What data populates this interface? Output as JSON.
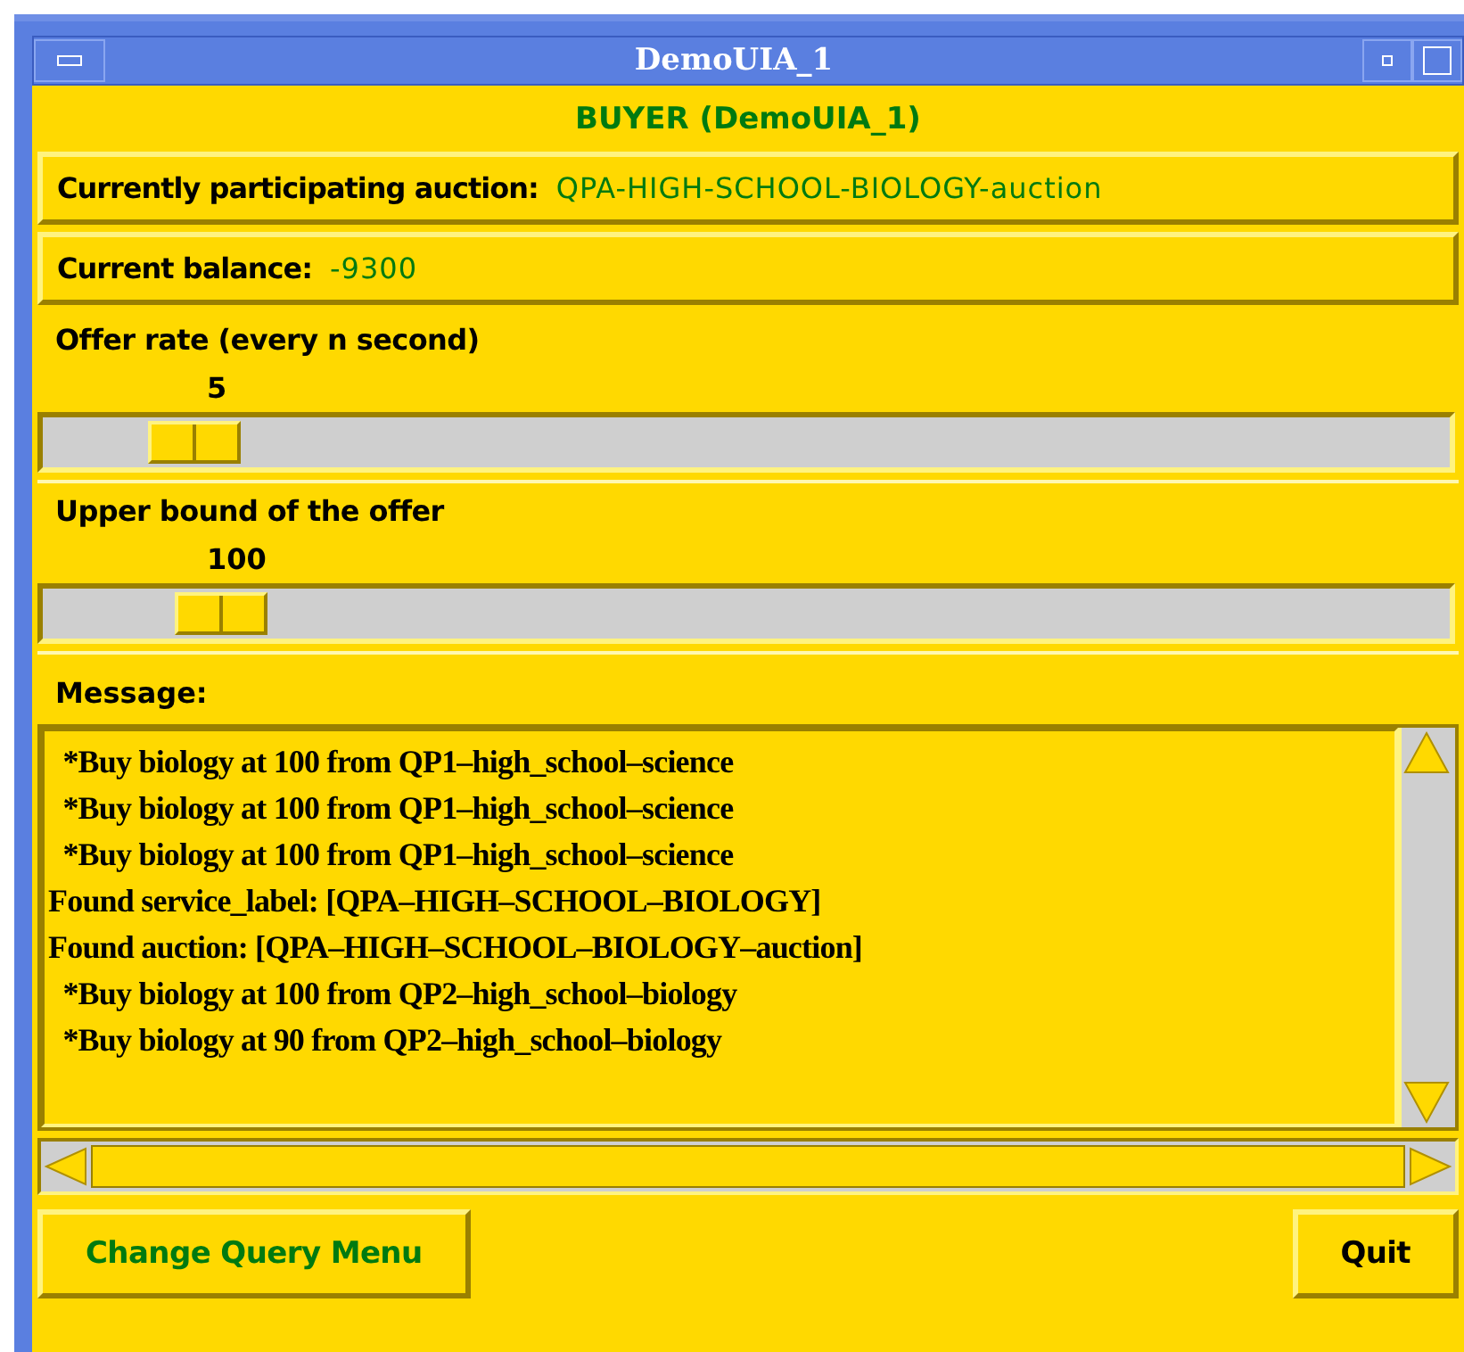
{
  "window": {
    "title": "DemoUIA_1"
  },
  "heading": "BUYER (DemoUIA_1)",
  "info": [
    {
      "label": "Currently participating auction:",
      "value": "QPA-HIGH-SCHOOL-BIOLOGY-auction"
    },
    {
      "label": "Current balance:",
      "value": "-9300"
    }
  ],
  "sliders": [
    {
      "label": "Offer rate (every n second)",
      "reading": "5",
      "level": 0.08
    },
    {
      "label": "Upper bound of the offer",
      "reading": "100",
      "level": 0.1
    }
  ],
  "message": {
    "label": "Message:",
    "lines": [
      "  *Buy biology at 100 from QP1–high_school–science",
      "  *Buy biology at 100 from QP1–high_school–science",
      "  *Buy biology at 100 from QP1–high_school–science",
      "Found service_label: [QPA–HIGH–SCHOOL–BIOLOGY]",
      "Found auction: [QPA–HIGH–SCHOOL–BIOLOGY–auction]",
      "  *Buy biology at 100 from QP2–high_school–biology",
      "  *Buy biology at 90 from QP2–high_school–biology"
    ]
  },
  "buttons": [
    {
      "label": "Change Query Menu",
      "kind": "accent"
    },
    {
      "label": "Quit",
      "kind": "plain"
    }
  ]
}
